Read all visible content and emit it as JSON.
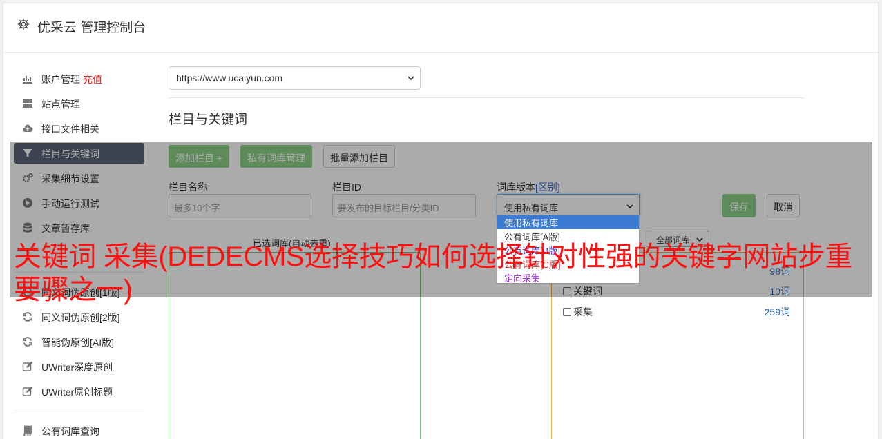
{
  "app_title": "优采云 管理控制台",
  "sidebar": {
    "items": [
      {
        "label": "账户管理",
        "extra": "充值",
        "icon": "bar-chart-icon"
      },
      {
        "label": "站点管理",
        "icon": "server-icon"
      },
      {
        "label": "接口文件相关",
        "icon": "cloud-upload-icon"
      },
      {
        "label": "栏目与关键词",
        "icon": "filter-icon",
        "active": true
      },
      {
        "label": "采集细节设置",
        "icon": "gears-icon"
      },
      {
        "label": "手动运行测试",
        "icon": "play-circle-icon"
      },
      {
        "label": "文章暂存库",
        "icon": "database-icon"
      },
      {
        "label": "同义词伪原创[1版]",
        "icon": "refresh-icon"
      },
      {
        "label": "同义词伪原创[2版]",
        "icon": "refresh-icon"
      },
      {
        "label": "智能伪原创[AI版]",
        "icon": "refresh-icon"
      },
      {
        "label": "UWriter深度原创",
        "icon": "edit-icon"
      },
      {
        "label": "UWriter原创标题",
        "icon": "edit-icon"
      },
      {
        "label": "公有词库查询",
        "icon": "book-icon"
      }
    ]
  },
  "site_select": {
    "value": "https://www.ucaiyun.com"
  },
  "section_title": "栏目与关键词",
  "buttons": {
    "add_column": "添加栏目 +",
    "private_dict": "私有词库管理",
    "batch_add": "批量添加栏目",
    "save": "保存",
    "cancel": "取消"
  },
  "form": {
    "column_name_label": "栏目名称",
    "column_name_placeholder": "最多10个字",
    "column_id_label": "栏目ID",
    "column_id_placeholder": "要发布的目标栏目/分类ID",
    "dict_version_label": "词库版本",
    "dict_version_link": "[区别]",
    "dict_version_value": "使用私有词库"
  },
  "dropdown_options": [
    {
      "label": "使用私有词库",
      "color": "#ffffff",
      "selected": true
    },
    {
      "label": "公有词库[A版]",
      "color": "#333333"
    },
    {
      "label": "公有词库[B版]",
      "color": "#3333cc"
    },
    {
      "label": "公有词库[C版]",
      "color": "#cc3333"
    },
    {
      "label": "定向采集",
      "color": "#9933cc"
    }
  ],
  "selected_box_label": "已选词库(自动去重)",
  "all_dict_select": "全部词库",
  "dict_list": [
    {
      "label": "",
      "count": "98词"
    },
    {
      "label": "关键词",
      "count": "10词"
    },
    {
      "label": "采集",
      "count": "259词"
    }
  ],
  "overlay_title": "关键词 采集(DEDECMS选择技巧如何选择针对性强的关键字网站步重要骤之一)",
  "colors": {
    "green": "#8dcf86",
    "active_sidebar": "#5b6378",
    "red_title": "#ff1010",
    "selected_box_border": "#7cc07a",
    "dict_box_border": "#f0ad4e"
  }
}
